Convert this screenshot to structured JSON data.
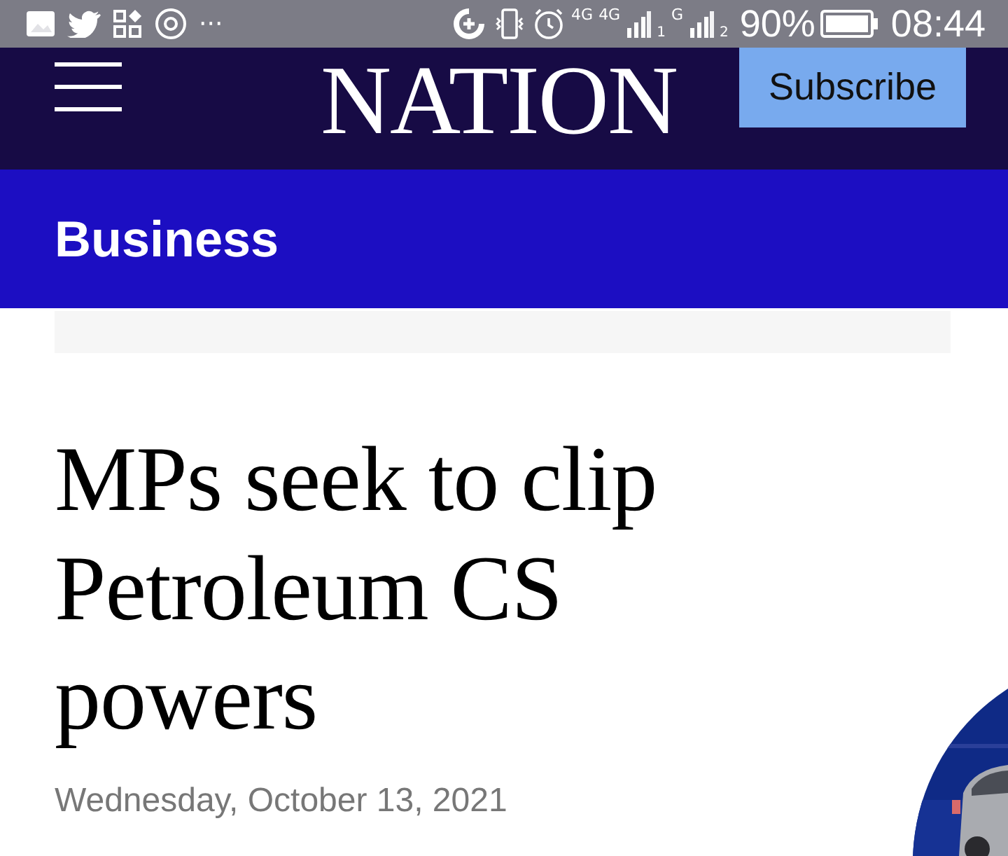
{
  "status_bar": {
    "more": "···",
    "network_1": "4G",
    "network_2": "4G",
    "sim_1": "1",
    "network_3": "G",
    "sim_2": "2",
    "battery": "90%",
    "time": "08:44"
  },
  "header": {
    "logo": "NATION",
    "subscribe": "Subscribe"
  },
  "section": {
    "title": "Business"
  },
  "article": {
    "headline": "MPs seek to clip Petroleum CS powers",
    "date": "Wednesday, October 13, 2021"
  }
}
